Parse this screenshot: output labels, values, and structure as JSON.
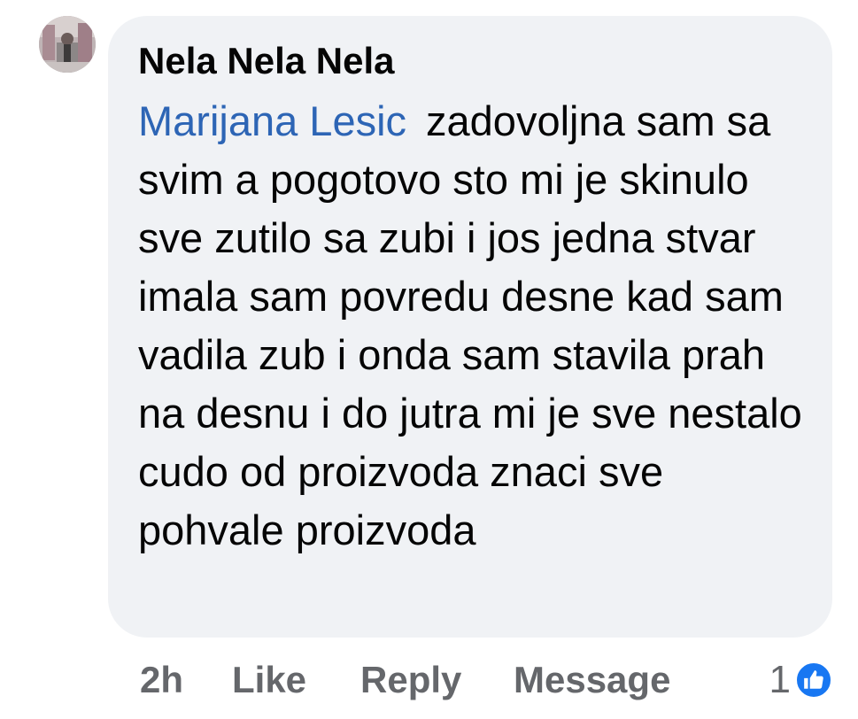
{
  "comment": {
    "author": "Nela Nela Nela",
    "mention": "Marijana Lesic",
    "text": "zadovoljna sam sa svim a pogotovo sto mi je skinulo sve zutilo sa zubi i jos jedna stvar imala sam povredu desne kad sam vadila zub i onda sam stavila prah na desnu i do jutra mi je sve nestalo cudo od proizvoda znaci sve pohvale proizvoda"
  },
  "actions": {
    "time": "2h",
    "like_label": "Like",
    "reply_label": "Reply",
    "message_label": "Message"
  },
  "reactions": {
    "count": "1",
    "icon": "like-thumb-icon",
    "badge_color": "#1877f2"
  },
  "colors": {
    "bubble_bg": "#f0f2f5",
    "mention": "#2d65b5",
    "muted_text": "#65676b",
    "text": "#050505"
  }
}
